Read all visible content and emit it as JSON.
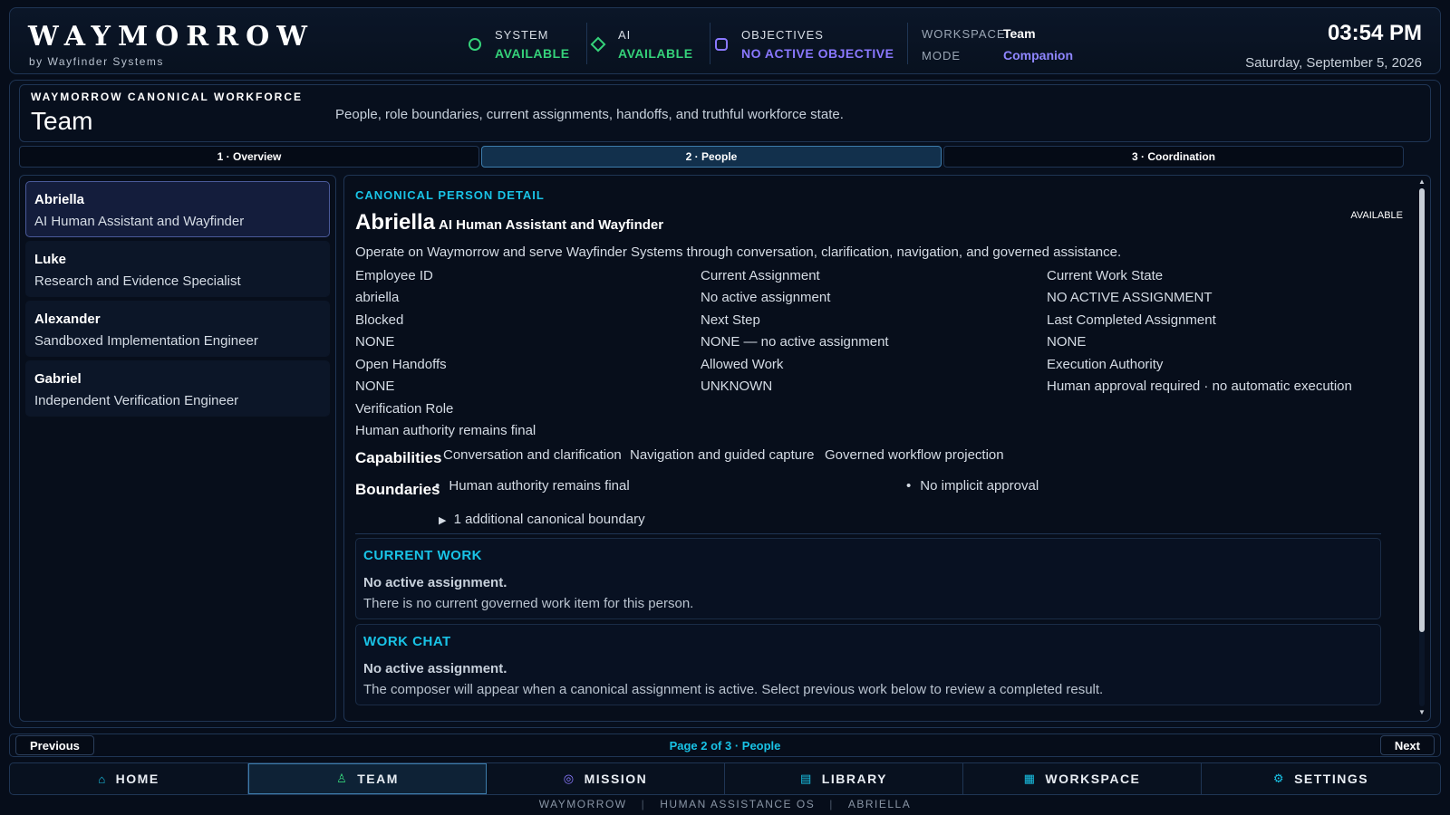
{
  "brand": {
    "title": "WAYMORROW",
    "subtitle": "by Wayfinder Systems"
  },
  "status": {
    "system": {
      "label": "SYSTEM",
      "value": "AVAILABLE",
      "icon": "circle-status-icon",
      "color": "#35d27a"
    },
    "ai": {
      "label": "AI",
      "value": "AVAILABLE",
      "icon": "diamond-status-icon",
      "color": "#35d27a"
    },
    "objectives": {
      "label": "OBJECTIVES",
      "value": "NO ACTIVE OBJECTIVE",
      "icon": "square-status-icon",
      "color": "#8a78ff"
    }
  },
  "workspace": {
    "workspace_label": "WORKSPACE",
    "workspace_value": "Team",
    "mode_label": "MODE",
    "mode_value": "Companion"
  },
  "clock": {
    "time": "03:54 PM",
    "date": "Saturday, September 5, 2026"
  },
  "hero": {
    "kicker": "WAYMORROW CANONICAL WORKFORCE",
    "title": "Team",
    "description": "People, role boundaries, current assignments, handoffs, and truthful workforce state."
  },
  "tabs": [
    {
      "label": "1 · Overview",
      "active": false
    },
    {
      "label": "2 · People",
      "active": true
    },
    {
      "label": "3 · Coordination",
      "active": false
    }
  ],
  "people": [
    {
      "name": "Abriella",
      "role": "AI Human Assistant and Wayfinder",
      "selected": true
    },
    {
      "name": "Luke",
      "role": "Research and Evidence Specialist",
      "selected": false
    },
    {
      "name": "Alexander",
      "role": "Sandboxed Implementation Engineer",
      "selected": false
    },
    {
      "name": "Gabriel",
      "role": "Independent Verification Engineer",
      "selected": false
    }
  ],
  "detail": {
    "kicker": "CANONICAL PERSON DETAIL",
    "name": "Abriella",
    "role": "AI Human Assistant and Wayfinder",
    "status": "AVAILABLE",
    "description": "Operate on Waymorrow and serve Wayfinder Systems through conversation, clarification, navigation, and governed assistance.",
    "fields": [
      {
        "label": "Employee ID",
        "value": "abriella"
      },
      {
        "label": "Current Assignment",
        "value": "No active assignment"
      },
      {
        "label": "Current Work State",
        "value": "NO ACTIVE ASSIGNMENT"
      },
      {
        "label": "Blocked",
        "value": "NONE"
      },
      {
        "label": "Next Step",
        "value": "NONE — no active assignment"
      },
      {
        "label": "Last Completed Assignment",
        "value": "NONE"
      },
      {
        "label": "Open Handoffs",
        "value": "NONE"
      },
      {
        "label": "Allowed Work",
        "value": "UNKNOWN"
      },
      {
        "label": "Execution Authority",
        "value": "Human approval required · no automatic execution"
      },
      {
        "label": "Verification Role",
        "value": "Human authority remains final"
      }
    ],
    "capabilities_label": "Capabilities",
    "capabilities": [
      "Conversation and clarification",
      "Navigation and guided capture",
      "Governed workflow projection"
    ],
    "boundaries_label": "Boundaries",
    "boundaries": [
      "Human authority remains final",
      "No implicit approval"
    ],
    "boundaries_more": "1 additional canonical boundary",
    "current_work": {
      "title": "CURRENT WORK",
      "strong": "No active assignment.",
      "text": "There is no current governed work item for this person."
    },
    "work_chat": {
      "title": "WORK CHAT",
      "strong": "No active assignment.",
      "text": "The composer will appear when a canonical assignment is active. Select previous work below to review a completed result."
    }
  },
  "pager": {
    "previous": "Previous",
    "text": "Page 2 of 3 · People",
    "next": "Next"
  },
  "nav": [
    {
      "label": "HOME",
      "icon": "home-icon",
      "glyph": "⌂",
      "active": false
    },
    {
      "label": "TEAM",
      "icon": "person-icon",
      "glyph": "♙",
      "active": true
    },
    {
      "label": "MISSION",
      "icon": "target-icon",
      "glyph": "◎",
      "active": false
    },
    {
      "label": "LIBRARY",
      "icon": "library-icon",
      "glyph": "▤",
      "active": false
    },
    {
      "label": "WORKSPACE",
      "icon": "grid-icon",
      "glyph": "▦",
      "active": false
    },
    {
      "label": "SETTINGS",
      "icon": "gear-icon",
      "glyph": "⚙",
      "active": false
    }
  ],
  "footer": [
    "WAYMORROW",
    "HUMAN ASSISTANCE OS",
    "ABRIELLA"
  ],
  "colors": {
    "accent": "#19c3e6",
    "available": "#35d27a",
    "objective": "#8a78ff",
    "mode": "#8f86ff"
  }
}
